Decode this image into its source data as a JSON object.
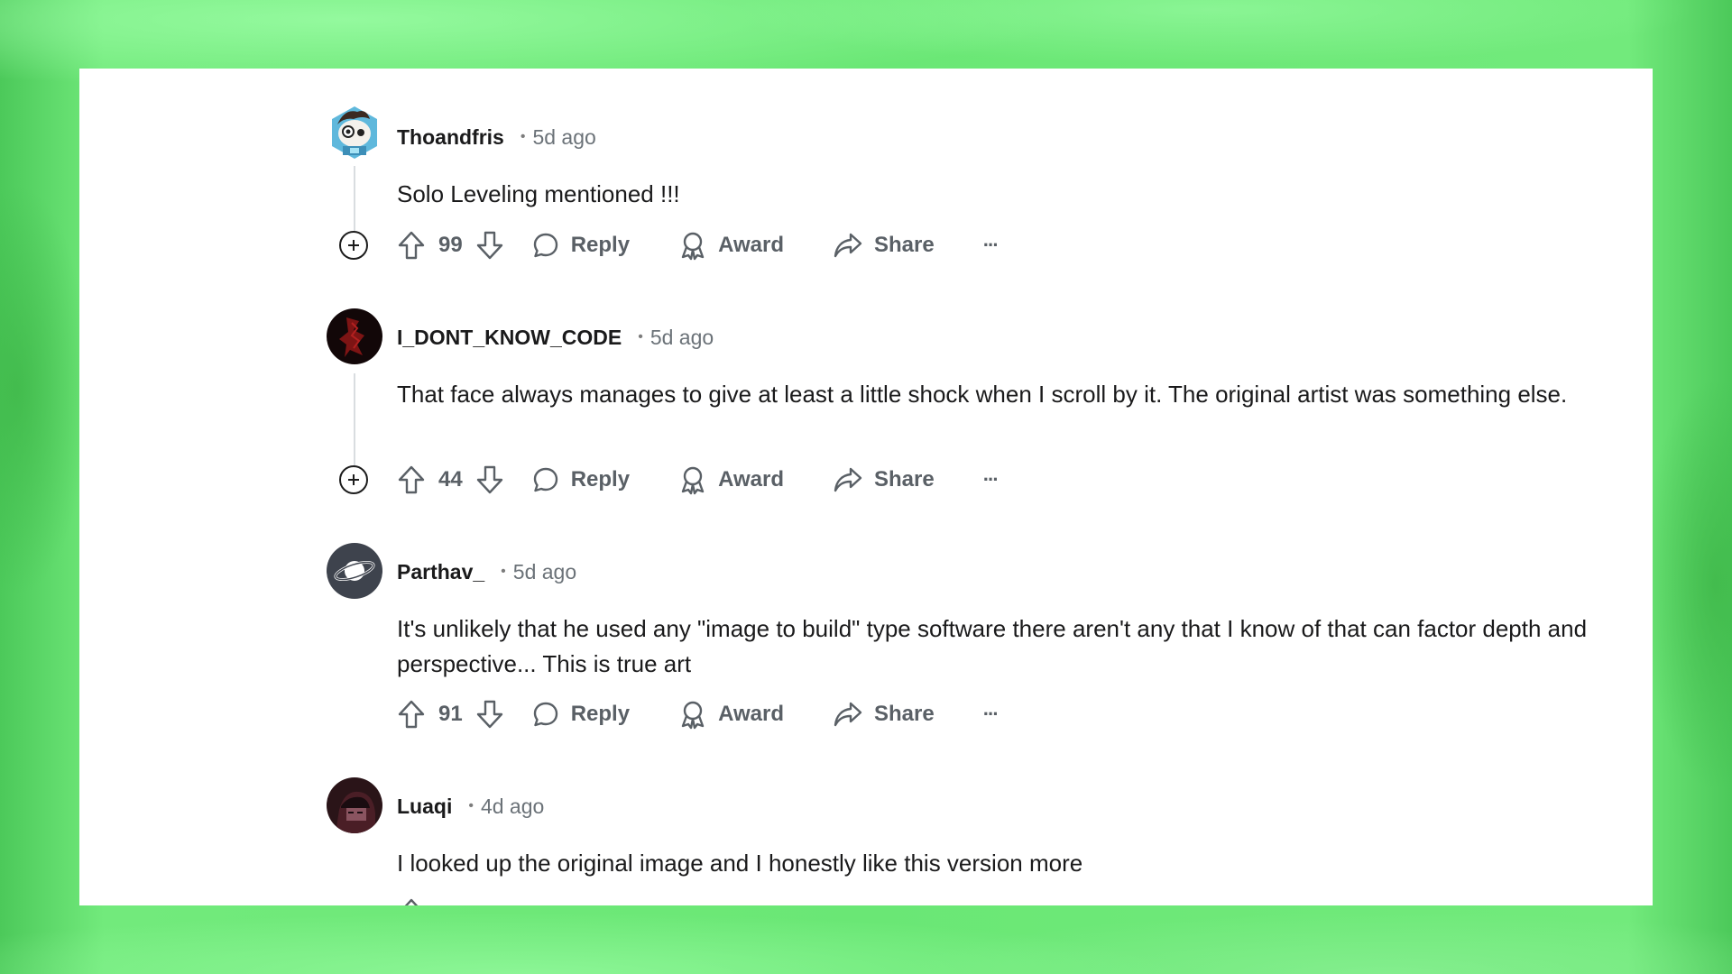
{
  "comments": [
    {
      "author": "Thoandfris",
      "time": "5d ago",
      "text": "Solo Leveling mentioned !!!",
      "votes": "99",
      "avatar": "snoo-avatar-icon"
    },
    {
      "author": "I_DONT_KNOW_CODE",
      "time": "5d ago",
      "text": "That face always manages to give at least a little shock when I scroll by it. The original artist was something else.",
      "votes": "44",
      "avatar": "dark-red-art-avatar"
    },
    {
      "author": "Parthav_",
      "time": "5d ago",
      "text": "It's unlikely that he used any \"image to build\" type software there aren't any that I know of that can factor depth and perspective... This is true art",
      "votes": "91",
      "avatar": "planet-avatar-icon"
    },
    {
      "author": "Luaqi",
      "time": "4d ago",
      "text": "I looked up the original image and I honestly like this version more",
      "avatar": "anime-character-avatar"
    }
  ],
  "actions": {
    "reply": "Reply",
    "award": "Award",
    "share": "Share",
    "more": "···"
  },
  "colors": {
    "background_green": "#6ae775",
    "panel": "#ffffff",
    "text": "#1a1a1b",
    "muted": "#5a6066"
  }
}
